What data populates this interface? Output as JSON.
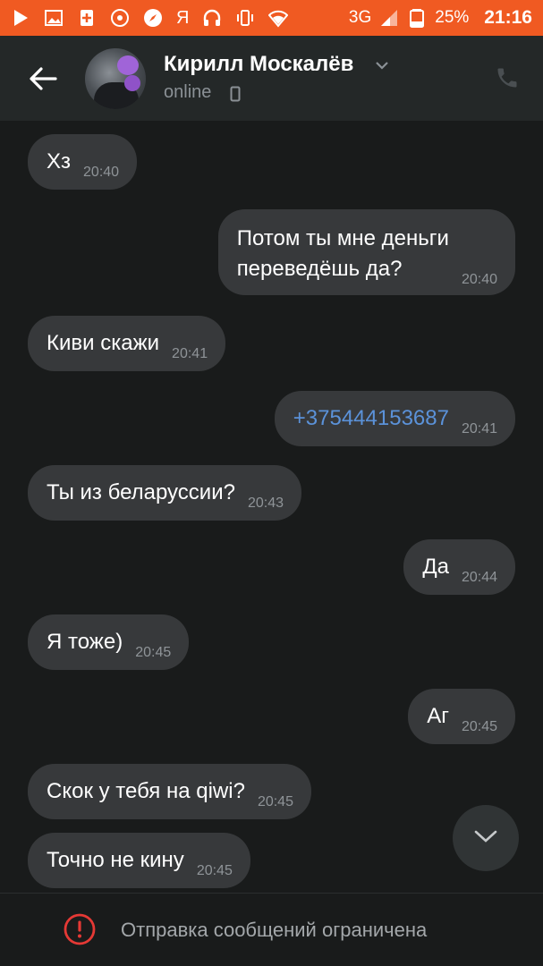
{
  "status_bar": {
    "icons": [
      "play-icon",
      "image-icon",
      "plus-icon",
      "disc-icon",
      "compass-icon",
      "yandex-icon",
      "headset-icon",
      "vibrate-icon",
      "wifi-icon",
      "signal-icon",
      "battery-icon"
    ],
    "yandex": "Я",
    "network": "3G",
    "battery": "25%",
    "time": "21:16"
  },
  "header": {
    "name": "Кирилл Москалёв",
    "status": "online"
  },
  "messages": [
    {
      "side": "in",
      "text": "Хз",
      "time": "20:40"
    },
    {
      "side": "out",
      "text": "Потом ты мне деньги\nпереведёшь да?",
      "time": "20:40"
    },
    {
      "side": "in",
      "text": "Киви скажи",
      "time": "20:41"
    },
    {
      "side": "out",
      "text": "+375444153687",
      "time": "20:41",
      "is_link": true
    },
    {
      "side": "in",
      "text": "Ты из беларуссии?",
      "time": "20:43"
    },
    {
      "side": "out",
      "text": "Да",
      "time": "20:44"
    },
    {
      "side": "in",
      "text": "Я тоже)",
      "time": "20:45"
    },
    {
      "side": "out",
      "text": "Аг",
      "time": "20:45"
    },
    {
      "side": "in",
      "text": "Скок у тебя на qiwi?",
      "time": "20:45"
    },
    {
      "side": "in",
      "text": "Точно не кину",
      "time": "20:45"
    }
  ],
  "footer": {
    "notice": "Отправка сообщений ограничена"
  },
  "colors": {
    "status_bar": "#f05a22",
    "header_bg": "#242828",
    "chat_bg": "#191b1b",
    "bubble": "#37393b",
    "link": "#5b92d9",
    "alert_red": "#e53935"
  }
}
